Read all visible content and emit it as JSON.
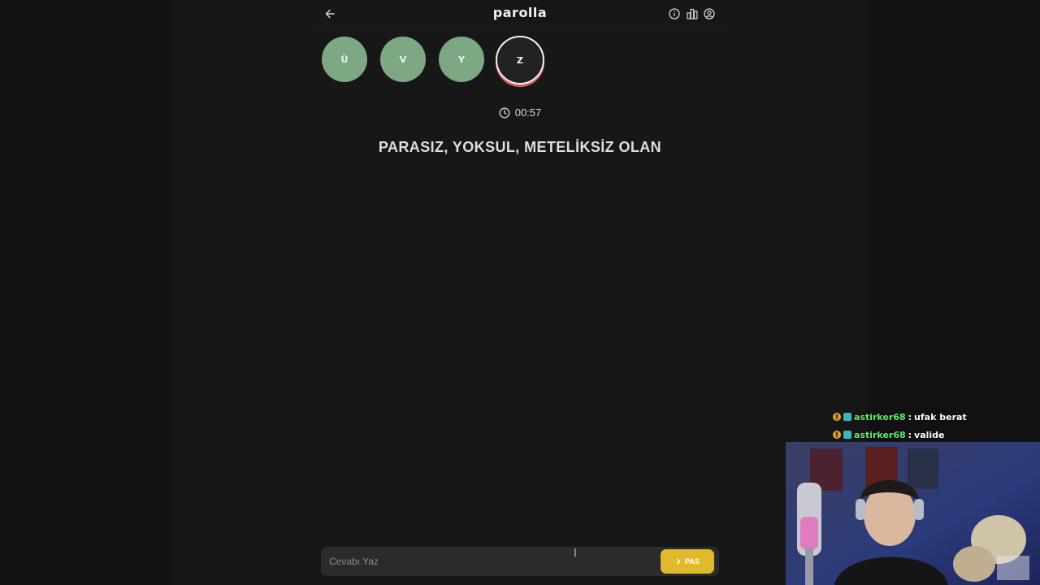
{
  "app": {
    "title": "parolla"
  },
  "letters": [
    {
      "letter": "Ü",
      "state": "answered"
    },
    {
      "letter": "V",
      "state": "answered"
    },
    {
      "letter": "Y",
      "state": "answered"
    },
    {
      "letter": "Z",
      "state": "active"
    }
  ],
  "timer": "00:57",
  "question": "PARASIZ, YOKSUL, METELİKSİZ OLAN",
  "answer": {
    "placeholder": "Cevabı Yaz",
    "value": "",
    "pass_label": "PAS"
  },
  "chat": [
    {
      "user": "astirker68",
      "separator": ":",
      "message": "ufak berat"
    },
    {
      "user": "astirker68",
      "separator": ":",
      "message": "valide"
    }
  ],
  "colors": {
    "answered": "#7ea884",
    "active_ring": "#e05a5a",
    "pass_button": "#e3b92c",
    "chat_user": "#5cf06a"
  },
  "icons": [
    "back-arrow-icon",
    "info-icon",
    "stats-icon",
    "user-icon",
    "clock-icon",
    "chevron-right-icon"
  ]
}
